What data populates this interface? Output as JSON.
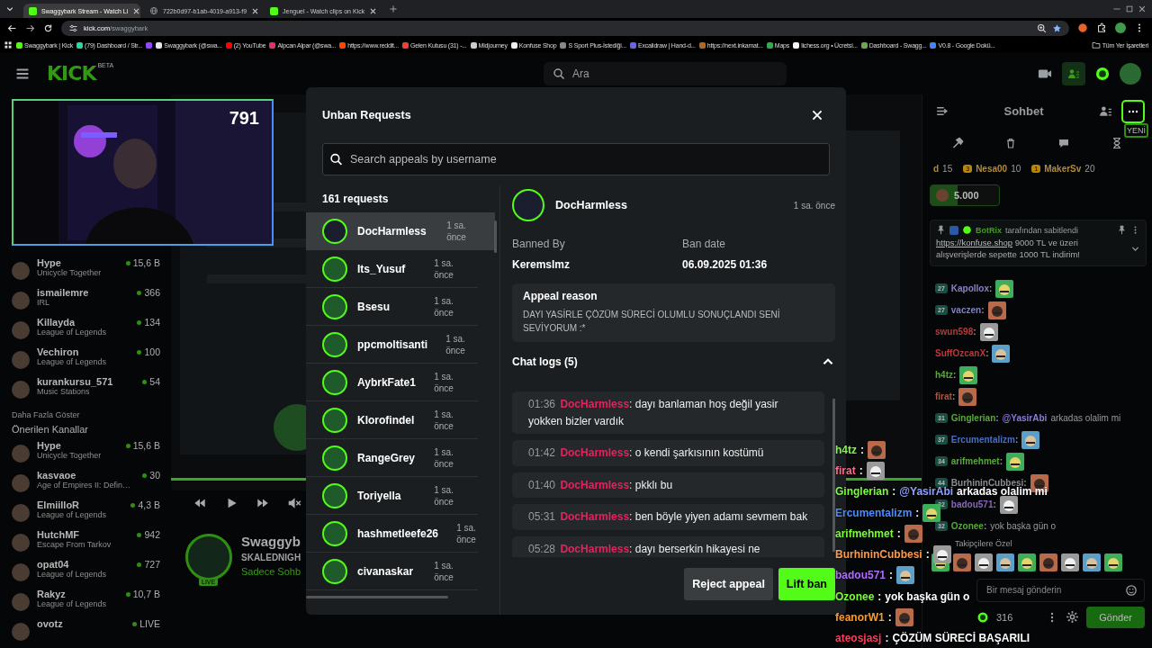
{
  "browser": {
    "tabs": [
      {
        "title": "Swaggybark Stream - Watch Li",
        "kind": "kick",
        "selected": true
      },
      {
        "title": "722b0d97-b1ab-4019-a913-f9",
        "kind": "page",
        "selected": false
      },
      {
        "title": "Jenguel - Watch clips on Kick",
        "kind": "kick",
        "selected": false
      }
    ],
    "address": {
      "host": "kick.com",
      "path": "/swaggybark"
    },
    "bookmarks": [
      {
        "title": "Swaggybark | Kick",
        "color": "#53fc18"
      },
      {
        "title": "(79) Dashboard / Str...",
        "color": "#2bd4a3"
      },
      {
        "color": "#9146ff"
      },
      {
        "title": "Swaggybark (@swa...",
        "color": "#e8e8e8"
      },
      {
        "title": "(2) YouTube",
        "color": "#ff0000"
      },
      {
        "title": "Alpcan Alpar (@swa...",
        "color": "#e1306c"
      },
      {
        "title": "https://www.reddit...",
        "color": "#ff4500"
      },
      {
        "title": "Gelen Kutusu (31) -...",
        "color": "#ea4335"
      },
      {
        "title": "Midjourney",
        "color": "#cccccc"
      },
      {
        "title": "Konfuse Shop",
        "color": "#f0f0f0"
      },
      {
        "title": "S Sport Plus-İstediği...",
        "color": "#888888"
      },
      {
        "title": "Excalidraw | Hand-d...",
        "color": "#6965db"
      },
      {
        "title": "https://next.inkamat...",
        "color": "#b5651d"
      },
      {
        "title": "Maps",
        "color": "#34a853"
      },
      {
        "title": "lichess.org • Ücretsi...",
        "color": "#f5f5f5"
      },
      {
        "title": "Dashboard - Swagg...",
        "color": "#6aa84f"
      },
      {
        "title": "V0.8 - Google Dokü...",
        "color": "#4285f4"
      }
    ],
    "all_bookmarks": "Tüm Yer İşaretleri"
  },
  "header": {
    "logo": "KICK",
    "logo_badge": "BETA",
    "search": {
      "placeholder": "Ara"
    }
  },
  "webcam": {
    "viewer_count": "791"
  },
  "sidebar": {
    "followed": [
      {
        "name": "Hype",
        "category": "Unicycle Together",
        "viewers": "15,6 B"
      },
      {
        "name": "ismailemre",
        "category": "IRL",
        "viewers": "366"
      },
      {
        "name": "Killayda",
        "category": "League of Legends",
        "viewers": "134"
      },
      {
        "name": "Vechiron",
        "category": "League of Legends",
        "viewers": "100"
      },
      {
        "name": "kurankursu_571",
        "category": "Music Stations",
        "viewers": "54"
      }
    ],
    "more": "Daha Fazla Göster",
    "recommended_title": "Önerilen Kanallar",
    "recommended": [
      {
        "name": "Hype",
        "category": "Unicycle Together",
        "viewers": "15,6 B"
      },
      {
        "name": "kasvaoe",
        "category": "Age of Empires II: Defin…",
        "viewers": "30"
      },
      {
        "name": "ElmiilloR",
        "category": "League of Legends",
        "viewers": "4,3 B"
      },
      {
        "name": "HutchMF",
        "category": "Escape From Tarkov",
        "viewers": "942"
      },
      {
        "name": "opat04",
        "category": "League of Legends",
        "viewers": "727"
      },
      {
        "name": "Rakyz",
        "category": "League of Legends",
        "viewers": "10,7 B"
      },
      {
        "name": "ovotz",
        "viewers": "LIVE"
      }
    ]
  },
  "stream": {
    "name": "Swaggyb",
    "title": "SKALEDNIGH",
    "category": "Sadece Sohb",
    "live": "LIVE"
  },
  "chat": {
    "title": "Sohbet",
    "new_badge": "YENİ",
    "leaderboard": [
      {
        "name": "d",
        "value": "15"
      },
      {
        "rank": "3",
        "name": "Nesa00",
        "value": "10"
      },
      {
        "rank": "1",
        "name": "MakerSv",
        "value": "20"
      }
    ],
    "goal": {
      "amount": "5.000",
      "level": 0.4
    },
    "pinned": {
      "by": "BotRix",
      "by_suffix": "tarafından sabitlendi",
      "link": "https://konfuse.shop",
      "text": " 9000 TL ve üzeri alışverişlerde sepette 1000 TL indirim!"
    },
    "separator": ":",
    "messages": [
      {
        "badge": "27",
        "name": "Kapollox",
        "color": "#8a80c0",
        "kind": "emote"
      },
      {
        "badge": "27",
        "name": "vaczen",
        "color": "#8080c0",
        "kind": "emote"
      },
      {
        "name": "swun598",
        "color": "#b83a3a",
        "kind": "emote"
      },
      {
        "name": "SuffOzcanX",
        "color": "#b83a3a",
        "kind": "emote"
      },
      {
        "name": "h4tz",
        "color": "#5aa83c",
        "kind": "emote"
      },
      {
        "name": "firat",
        "color": "#a85a44",
        "kind": "emote"
      },
      {
        "badge": "31",
        "name": "Ginglerian",
        "color": "#5aa83c",
        "kind": "text",
        "mention": "@YasirAbi",
        "text": "arkadas olalim mi"
      },
      {
        "badge": "37",
        "name": "Ercumentalizm",
        "color": "#4a6fc0",
        "kind": "emote"
      },
      {
        "badge": "34",
        "name": "arifmehmet",
        "color": "#5aa83c",
        "kind": "emote"
      },
      {
        "badge": "44",
        "name": "BurhininCubbesi",
        "color": "#8c8c8c",
        "kind": "emote"
      },
      {
        "badge": "32",
        "name": "badou571",
        "color": "#8a66c0",
        "kind": "emote"
      },
      {
        "badge": "32",
        "name": "Ozonee",
        "color": "#5aa83c",
        "kind": "text",
        "text": "yok başka gün o"
      }
    ],
    "followers_only": "Takipçilere Özel",
    "input": {
      "placeholder": "Bir mesaj gönderin"
    },
    "points": "316",
    "send": "Gönder"
  },
  "overlay_chat": {
    "separator": ":",
    "lines": [
      {
        "name": "h4tz",
        "color": "#7cfc3c",
        "kind": "emote"
      },
      {
        "name": "firat",
        "color": "#ff6b8a",
        "kind": "emote"
      },
      {
        "name": "Ginglerian",
        "color": "#7cfc3c",
        "kind": "text",
        "mention": "@YasirAbi",
        "text": "arkadas olalim mi"
      },
      {
        "name": "Ercumentalizm",
        "color": "#4a8cff",
        "kind": "emote"
      },
      {
        "name": "arifmehmet",
        "color": "#7cfc3c",
        "kind": "emote"
      },
      {
        "name": "BurhininCubbesi",
        "color": "#ff9a4a",
        "kind": "emote"
      },
      {
        "name": "badou571",
        "color": "#b06bff",
        "kind": "emote"
      },
      {
        "name": "Ozonee",
        "color": "#7cfc3c",
        "kind": "text",
        "text": "yok başka gün o"
      },
      {
        "name": "feanorW1",
        "color": "#ff9a2a",
        "kind": "emote"
      },
      {
        "name": "ateosjasj",
        "color": "#ff3b5c",
        "kind": "text",
        "text": "ÇÖZÜM SÜRECİ BAŞARILI"
      }
    ]
  },
  "modal": {
    "title": "Unban Requests",
    "search": {
      "placeholder": "Search appeals by username"
    },
    "count": "161 requests",
    "requests": [
      {
        "name": "DocHarmless",
        "time": "1 sa. önce",
        "selected": true
      },
      {
        "name": "Its_Yusuf",
        "time": "1 sa. önce",
        "selected": false
      },
      {
        "name": "Bsesu",
        "time": "1 sa. önce",
        "selected": false
      },
      {
        "name": "ppcmoltisanti",
        "time": "1 sa. önce",
        "selected": false
      },
      {
        "name": "AybrkFate1",
        "time": "1 sa. önce",
        "selected": false
      },
      {
        "name": "Klorofindel",
        "time": "1 sa. önce",
        "selected": false
      },
      {
        "name": "RangeGrey",
        "time": "1 sa. önce",
        "selected": false
      },
      {
        "name": "Toriyella",
        "time": "1 sa. önce",
        "selected": false
      },
      {
        "name": "hashmetleefe26",
        "time": "1 sa. önce",
        "selected": false
      },
      {
        "name": "civanaskar",
        "time": "1 sa. önce",
        "selected": false
      }
    ],
    "detail": {
      "name": "DocHarmless",
      "time": "1 sa. önce",
      "banned_by_label": "Banned By",
      "banned_by": "Keremslmz",
      "ban_date_label": "Ban date",
      "ban_date": "06.09.2025 01:36",
      "reason_title": "Appeal reason",
      "reason": "DAYI YASİRLE ÇÖZÜM SÜRECİ OLUMLU SONUÇLANDI SENİ SEVİYORUM :*",
      "logs_title": "Chat logs (5)",
      "logs_expanded": true,
      "log_separator": ":",
      "logs": [
        {
          "time": "01:36",
          "user": "DocHarmless",
          "text": "dayı banlaman hoş değil yasir yokken bizler vardık"
        },
        {
          "time": "01:42",
          "user": "DocHarmless",
          "text": "o kendi şarkısının kostümü"
        },
        {
          "time": "01:40",
          "user": "DocHarmless",
          "text": "pkklı bu"
        },
        {
          "time": "05:31",
          "user": "DocHarmless",
          "text": "ben böyle yiyen adamı sevmem bak"
        },
        {
          "time": "05:28",
          "user": "DocHarmless",
          "text": "dayı berserkin hikayesi ne"
        }
      ]
    },
    "buttons": [
      {
        "label": "Reject appeal",
        "kind": "secondary"
      },
      {
        "label": "Lift ban",
        "kind": "primary"
      }
    ]
  }
}
